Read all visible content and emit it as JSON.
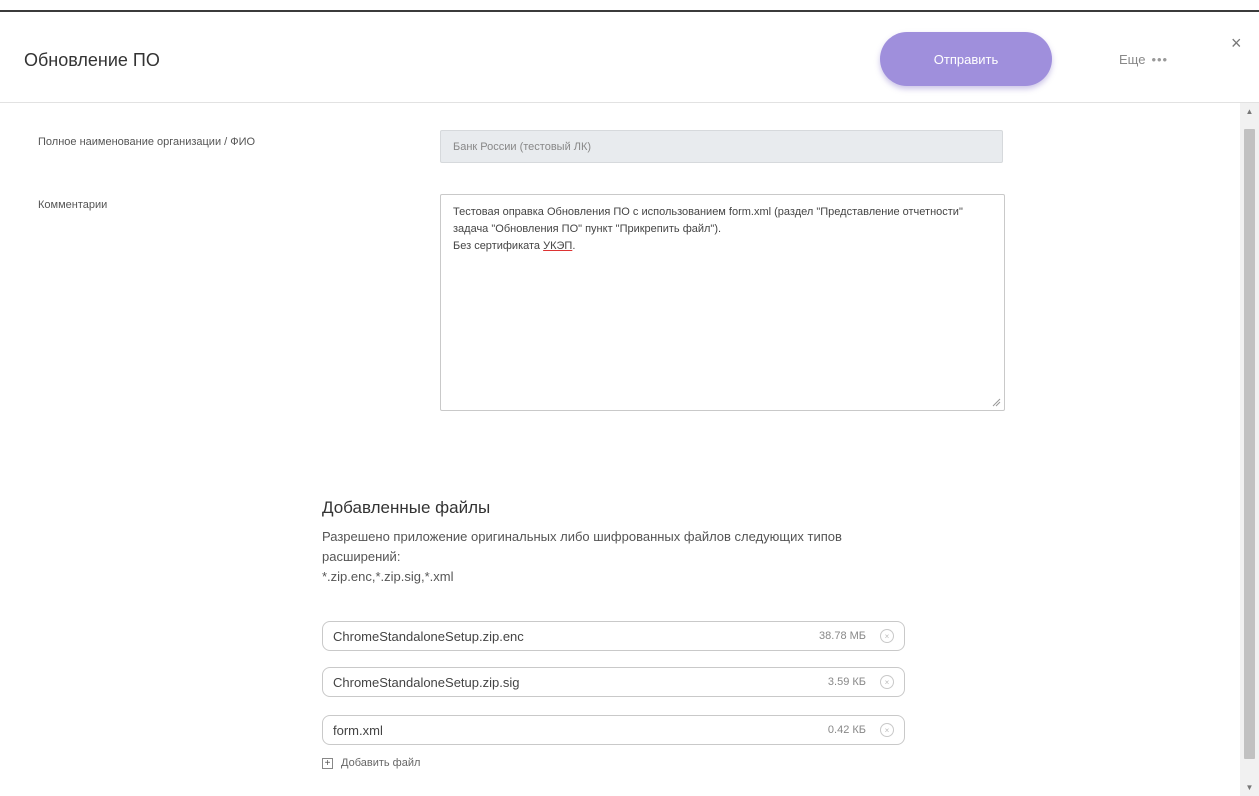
{
  "dialog": {
    "title": "Обновление ПО",
    "send_label": "Отправить",
    "more_label": "Еще",
    "more_dots": "•••",
    "close_glyph": "×"
  },
  "form": {
    "org_label": "Полное наименование организации / ФИО",
    "org_value": "Банк России (тестовый ЛК)",
    "comment_label": "Комментарии",
    "comment_text_main": "Тестовая оправка Обновления ПО с использованием form.xml (раздел \"Представление отчетности\" задача \"Обновления ПО\" пункт \"Прикрепить файл\").\nБез сертификата ",
    "comment_text_underlined": "УКЭП",
    "comment_text_end": "."
  },
  "files": {
    "title": "Добавленные файлы",
    "description": "Разрешено приложение оригинальных либо шифрованных файлов следующих типов расширений:",
    "extensions": "*.zip.enc,*.zip.sig,*.xml",
    "items": [
      {
        "name": "ChromeStandaloneSetup.zip.enc",
        "size": "38.78 МБ"
      },
      {
        "name": "ChromeStandaloneSetup.zip.sig",
        "size": "3.59 КБ"
      },
      {
        "name": "form.xml",
        "size": "0.42 КБ"
      }
    ],
    "add_label": "Добавить файл",
    "add_glyph": "+",
    "remove_glyph": "×"
  },
  "scrollbar": {
    "up_glyph": "▲",
    "down_glyph": "▼"
  },
  "colors": {
    "accent": "#9f8fdc",
    "field_disabled_bg": "#e8ebee"
  }
}
